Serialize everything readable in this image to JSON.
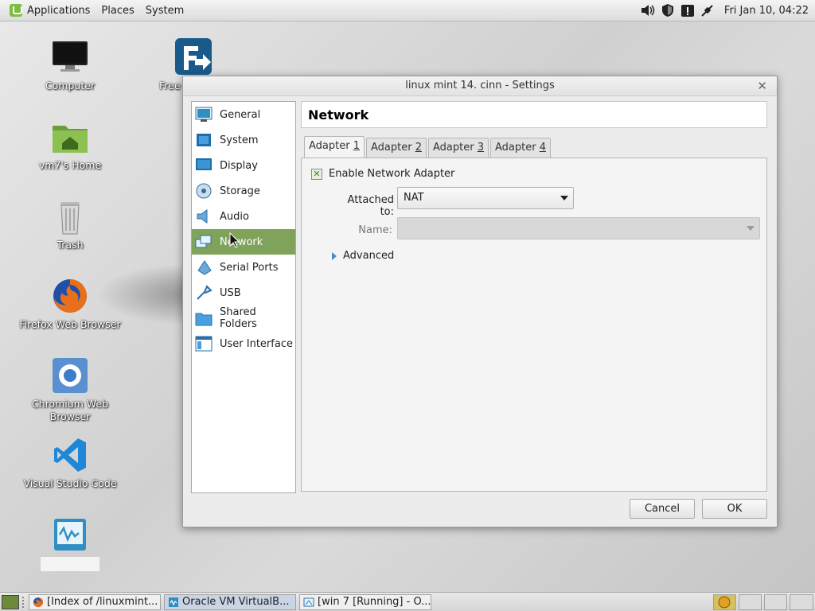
{
  "top_panel": {
    "menus": [
      "Applications",
      "Places",
      "System"
    ],
    "clock": "Fri Jan 10, 04:22",
    "tray_icons": [
      "volume-icon",
      "shield-icon",
      "update-manager-icon",
      "network-icon"
    ]
  },
  "desktop": {
    "icons": [
      {
        "label": "Computer",
        "icon": "monitor-icon"
      },
      {
        "label": "vm7's Home",
        "icon": "home-folder-icon"
      },
      {
        "label": "Trash",
        "icon": "trash-icon"
      },
      {
        "label": "Firefox Web Browser",
        "icon": "firefox-icon"
      },
      {
        "label": "Chromium Web Browser",
        "icon": "chromium-icon"
      },
      {
        "label": "Visual Studio Code",
        "icon": "vscode-icon"
      },
      {
        "label": "",
        "icon": "virtualbox-icon"
      }
    ],
    "partial_icon_label": "Free"
  },
  "dialog": {
    "title": "linux mint 14. cinn - Settings",
    "categories": [
      {
        "label": "General",
        "icon": "general-icon"
      },
      {
        "label": "System",
        "icon": "system-icon"
      },
      {
        "label": "Display",
        "icon": "display-icon"
      },
      {
        "label": "Storage",
        "icon": "storage-icon"
      },
      {
        "label": "Audio",
        "icon": "audio-icon"
      },
      {
        "label": "Network",
        "icon": "network-icon"
      },
      {
        "label": "Serial Ports",
        "icon": "serial-ports-icon"
      },
      {
        "label": "USB",
        "icon": "usb-icon"
      },
      {
        "label": "Shared Folders",
        "icon": "shared-folders-icon"
      },
      {
        "label": "User Interface",
        "icon": "user-interface-icon"
      }
    ],
    "selected_category": "Network",
    "page_title": "Network",
    "tabs": [
      {
        "prefix": "Adapter ",
        "num": "1"
      },
      {
        "prefix": "Adapter ",
        "num": "2"
      },
      {
        "prefix": "Adapter ",
        "num": "3"
      },
      {
        "prefix": "Adapter ",
        "num": "4"
      }
    ],
    "active_tab": "Adapter 1",
    "enable_label": "Enable Network Adapter",
    "enable_checked": true,
    "attached_label": "Attached to:",
    "attached_value": "NAT",
    "name_label": "Name:",
    "name_value": "",
    "advanced_label": "Advanced",
    "cancel_label": "Cancel",
    "ok_label": "OK"
  },
  "taskbar": {
    "tasks": [
      {
        "label": "[Index of /linuxmint...",
        "icon": "firefox-icon",
        "active": false
      },
      {
        "label": "Oracle VM VirtualB...",
        "icon": "virtualbox-icon",
        "active": true
      },
      {
        "label": "[win 7 [Running] - O...",
        "icon": "vm-window-icon",
        "active": false
      }
    ]
  },
  "colors": {
    "selected_category_bg": "#7fa35a",
    "accent_blue": "#4a8ad4"
  }
}
